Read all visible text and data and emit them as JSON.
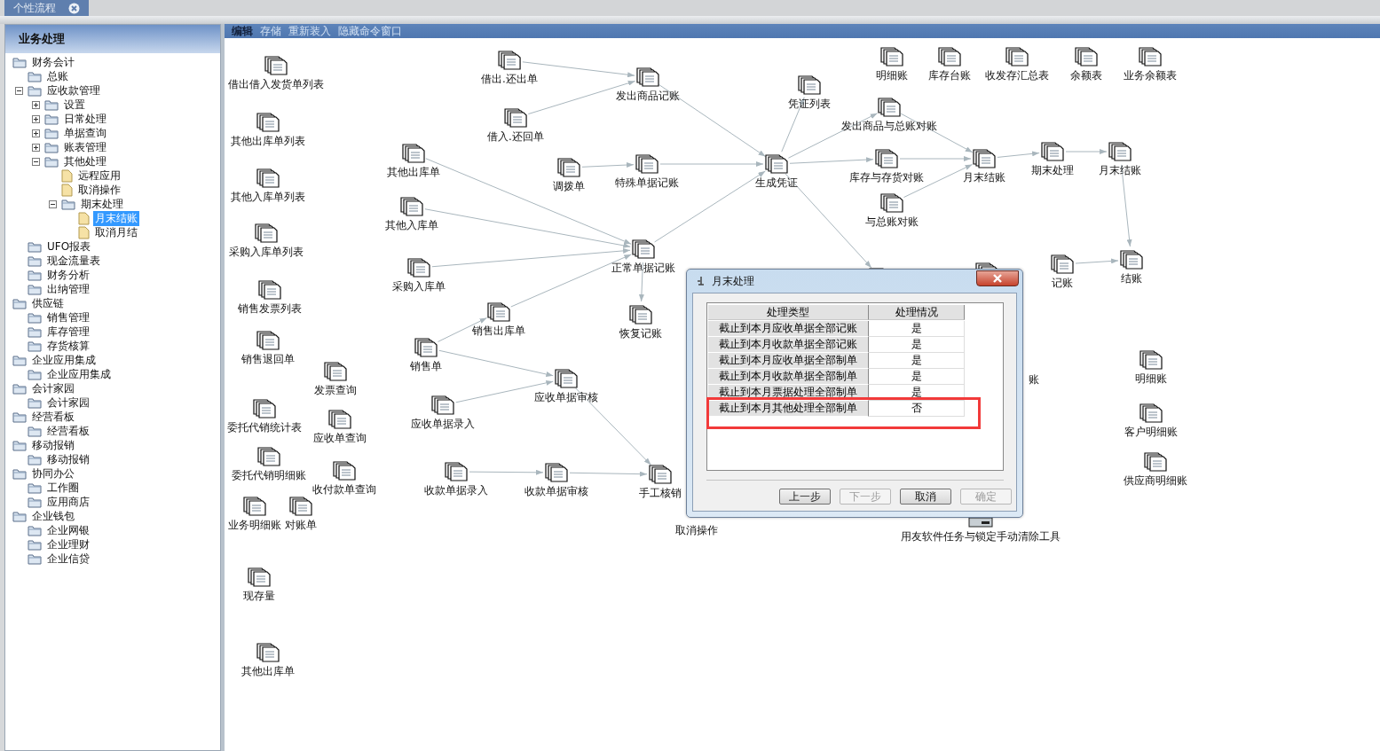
{
  "tab": {
    "label": "个性流程"
  },
  "sidebar": {
    "title": "业务处理",
    "tree": [
      {
        "label": "财务会计",
        "kind": "folder",
        "selected": false,
        "children": [
          {
            "label": "总账",
            "kind": "folder",
            "selected": false
          },
          {
            "label": "应收款管理",
            "kind": "folder",
            "expanded": true,
            "selected": false,
            "children": [
              {
                "label": "设置",
                "kind": "folder",
                "expanded": false,
                "selected": false
              },
              {
                "label": "日常处理",
                "kind": "folder",
                "expanded": false,
                "selected": false
              },
              {
                "label": "单据查询",
                "kind": "folder",
                "expanded": false,
                "selected": false
              },
              {
                "label": "账表管理",
                "kind": "folder",
                "expanded": false,
                "selected": false
              },
              {
                "label": "其他处理",
                "kind": "folder",
                "expanded": true,
                "selected": false,
                "children": [
                  {
                    "label": "远程应用",
                    "kind": "document",
                    "selected": false
                  },
                  {
                    "label": "取消操作",
                    "kind": "document",
                    "selected": false
                  },
                  {
                    "label": "期末处理",
                    "kind": "folder",
                    "expanded": true,
                    "selected": false,
                    "children": [
                      {
                        "label": "月末结账",
                        "kind": "document",
                        "selected": true
                      },
                      {
                        "label": "取消月结",
                        "kind": "document",
                        "selected": false
                      }
                    ]
                  }
                ]
              }
            ]
          },
          {
            "label": "UFO报表",
            "kind": "folder",
            "selected": false
          },
          {
            "label": "现金流量表",
            "kind": "folder",
            "selected": false
          },
          {
            "label": "财务分析",
            "kind": "folder",
            "selected": false
          },
          {
            "label": "出纳管理",
            "kind": "folder",
            "selected": false
          }
        ]
      },
      {
        "label": "供应链",
        "kind": "folder",
        "selected": false,
        "children": [
          {
            "label": "销售管理",
            "kind": "folder",
            "selected": false
          },
          {
            "label": "库存管理",
            "kind": "folder",
            "selected": false
          },
          {
            "label": "存货核算",
            "kind": "folder",
            "selected": false
          }
        ]
      },
      {
        "label": "企业应用集成",
        "kind": "folder",
        "selected": false,
        "children": [
          {
            "label": "企业应用集成",
            "kind": "folder",
            "selected": false
          }
        ]
      },
      {
        "label": "会计家园",
        "kind": "folder",
        "selected": false,
        "children": [
          {
            "label": "会计家园",
            "kind": "folder",
            "selected": false
          }
        ]
      },
      {
        "label": "经营看板",
        "kind": "folder",
        "selected": false,
        "children": [
          {
            "label": "经营看板",
            "kind": "folder",
            "selected": false
          }
        ]
      },
      {
        "label": "移动报销",
        "kind": "folder",
        "selected": false,
        "children": [
          {
            "label": "移动报销",
            "kind": "folder",
            "selected": false
          }
        ]
      },
      {
        "label": "协同办公",
        "kind": "folder",
        "selected": false,
        "children": [
          {
            "label": "工作圈",
            "kind": "folder",
            "selected": false
          },
          {
            "label": "应用商店",
            "kind": "folder",
            "selected": false
          }
        ]
      },
      {
        "label": "企业钱包",
        "kind": "folder",
        "selected": false,
        "children": [
          {
            "label": "企业网银",
            "kind": "folder",
            "selected": false
          },
          {
            "label": "企业理财",
            "kind": "folder",
            "selected": false
          },
          {
            "label": "企业信贷",
            "kind": "folder",
            "selected": false
          }
        ]
      }
    ]
  },
  "toolbar": [
    {
      "label": "编辑",
      "disabled": false
    },
    {
      "label": "存储",
      "disabled": true
    },
    {
      "label": "重新装入",
      "disabled": true
    },
    {
      "label": "隐藏命令窗口",
      "disabled": true
    }
  ],
  "flow_nodes": [
    {
      "label": "借出借入发货单列表",
      "kind": "document"
    },
    {
      "label": "其他出库单列表",
      "kind": "document"
    },
    {
      "label": "其他入库单列表",
      "kind": "document"
    },
    {
      "label": "采购入库单列表",
      "kind": "document"
    },
    {
      "label": "销售发票列表",
      "kind": "document"
    },
    {
      "label": "销售退回单",
      "kind": "document"
    },
    {
      "label": "发票查询",
      "kind": "document"
    },
    {
      "label": "委托代销统计表",
      "kind": "document"
    },
    {
      "label": "应收单查询",
      "kind": "document"
    },
    {
      "label": "委托代销明细账",
      "kind": "document"
    },
    {
      "label": "收付款单查询",
      "kind": "document"
    },
    {
      "label": "业务明细账",
      "kind": "document"
    },
    {
      "label": "对账单",
      "kind": "document"
    },
    {
      "label": "现存量",
      "kind": "document"
    },
    {
      "label": "其他出库单",
      "kind": "document"
    },
    {
      "label": "借出.还出单",
      "kind": "document"
    },
    {
      "label": "借入.还回单",
      "kind": "document"
    },
    {
      "label": "发出商品记账",
      "kind": "document"
    },
    {
      "label": "其他出库单",
      "kind": "document"
    },
    {
      "label": "调拨单",
      "kind": "document"
    },
    {
      "label": "特殊单据记账",
      "kind": "document"
    },
    {
      "label": "其他入库单",
      "kind": "document"
    },
    {
      "label": "正常单据记账",
      "kind": "document"
    },
    {
      "label": "采购入库单",
      "kind": "document"
    },
    {
      "label": "恢复记账",
      "kind": "document"
    },
    {
      "label": "销售出库单",
      "kind": "document"
    },
    {
      "label": "销售单",
      "kind": "document"
    },
    {
      "label": "应收单据审核",
      "kind": "document"
    },
    {
      "label": "应收单据录入",
      "kind": "document"
    },
    {
      "label": "收款单据录入",
      "kind": "document"
    },
    {
      "label": "收款单据审核",
      "kind": "document"
    },
    {
      "label": "手工核销",
      "kind": "document"
    },
    {
      "label": "取消操作",
      "kind": "hidden"
    },
    {
      "label": "凭证列表",
      "kind": "document"
    },
    {
      "label": "生成凭证",
      "kind": "document"
    },
    {
      "label": "明细账",
      "kind": "document"
    },
    {
      "label": "库存台账",
      "kind": "document"
    },
    {
      "label": "收发存汇总表",
      "kind": "document"
    },
    {
      "label": "余额表",
      "kind": "document"
    },
    {
      "label": "业务余额表",
      "kind": "document"
    },
    {
      "label": "发出商品与总账对账",
      "kind": "document"
    },
    {
      "label": "库存与存货对账",
      "kind": "document"
    },
    {
      "label": "与总账对账",
      "kind": "document"
    },
    {
      "label": "月末结账",
      "kind": "document"
    },
    {
      "label": "期末处理",
      "kind": "document"
    },
    {
      "label": "月末结账",
      "kind": "document"
    },
    {
      "label": "记账",
      "kind": "document"
    },
    {
      "label": "结账",
      "kind": "document"
    },
    {
      "label": "明细账",
      "kind": "document"
    },
    {
      "label": "客户明细账",
      "kind": "document"
    },
    {
      "label": "供应商明细账",
      "kind": "document"
    },
    {
      "label": "用友软件任务与锁定手动清除工具",
      "kind": "computer"
    },
    {
      "label": "账",
      "kind": "hidden"
    }
  ],
  "dialog": {
    "title": "月末处理",
    "columns": [
      "处理类型",
      "处理情况"
    ],
    "rows": [
      {
        "type": "截止到本月应收单据全部记账",
        "status": "是",
        "marked": false
      },
      {
        "type": "截止到本月收款单据全部记账",
        "status": "是",
        "marked": false
      },
      {
        "type": "截止到本月应收单据全部制单",
        "status": "是",
        "marked": false
      },
      {
        "type": "截止到本月收款单据全部制单",
        "status": "是",
        "marked": false
      },
      {
        "type": "截止到本月票据处理全部制单",
        "status": "是",
        "marked": false
      },
      {
        "type": "截止到本月其他处理全部制单",
        "status": "否",
        "marked": true
      }
    ],
    "buttons": [
      {
        "label": "上一步",
        "disabled": false
      },
      {
        "label": "下一步",
        "disabled": true
      },
      {
        "label": "取消",
        "disabled": false
      },
      {
        "label": "确定",
        "disabled": true
      }
    ]
  }
}
